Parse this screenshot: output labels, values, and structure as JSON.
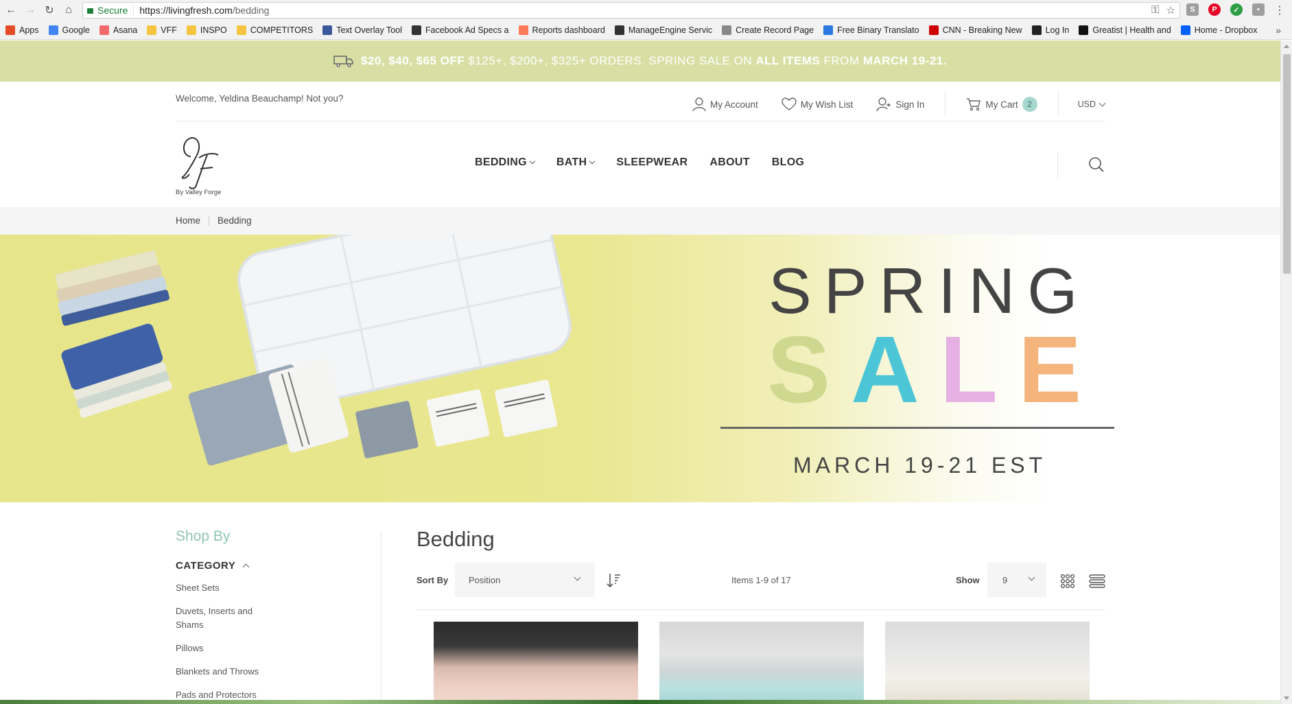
{
  "browser": {
    "secure_label": "Secure",
    "url_host": "https://livingfresh.com",
    "url_path": "/bedding",
    "bookmarks": [
      {
        "label": "Apps",
        "icon": "apps-grid-icon",
        "color": "#e34c26"
      },
      {
        "label": "Google",
        "icon": "google-icon",
        "color": "#4285f4"
      },
      {
        "label": "Asana",
        "icon": "asana-icon",
        "color": "#f06a6a"
      },
      {
        "label": "VFF",
        "icon": "folder-icon",
        "color": "#f5c542"
      },
      {
        "label": "INSPO",
        "icon": "folder-icon",
        "color": "#f5c542"
      },
      {
        "label": "COMPETITORS",
        "icon": "folder-icon",
        "color": "#f5c542"
      },
      {
        "label": "Text Overlay Tool",
        "icon": "facebook-icon",
        "color": "#3b5998"
      },
      {
        "label": "Facebook Ad Specs a",
        "icon": "layers-icon",
        "color": "#333333"
      },
      {
        "label": "Reports dashboard",
        "icon": "hubspot-icon",
        "color": "#ff7a59"
      },
      {
        "label": "ManageEngine Servic",
        "icon": "manageengine-icon",
        "color": "#333333"
      },
      {
        "label": "Create Record Page",
        "icon": "page-icon",
        "color": "#888888"
      },
      {
        "label": "Free Binary Translato",
        "icon": "w-icon",
        "color": "#2a7ae2"
      },
      {
        "label": "CNN - Breaking New",
        "icon": "cnn-icon",
        "color": "#cc0000"
      },
      {
        "label": "Log In",
        "icon": "big-icon",
        "color": "#222222"
      },
      {
        "label": "Greatist | Health and",
        "icon": "greatist-icon",
        "color": "#111111"
      },
      {
        "label": "Home - Dropbox",
        "icon": "dropbox-icon",
        "color": "#0061fe"
      }
    ]
  },
  "promo": {
    "amounts": "$20, $40, $65 OFF",
    "thresholds": "$125+, $200+, $325+ ORDERS. SPRING SALE ON",
    "all_items": "ALL ITEMS",
    "from": "FROM",
    "dates": "MARCH 19-21."
  },
  "topbar": {
    "welcome": "Welcome, Yeldina Beauchamp! Not you?",
    "my_account": "My Account",
    "wish_list": "My Wish List",
    "sign_in": "Sign In",
    "my_cart": "My Cart",
    "cart_count": "2",
    "currency": "USD"
  },
  "header": {
    "logo_sub": "By Valley Forge",
    "nav": [
      "BEDDING",
      "BATH",
      "SLEEPWEAR",
      "ABOUT",
      "BLOG"
    ]
  },
  "breadcrumb": {
    "home": "Home",
    "current": "Bedding"
  },
  "hero": {
    "line1": "SPRING",
    "sale_letters": [
      {
        "ch": "S",
        "color": "#cfd88f"
      },
      {
        "ch": "A",
        "color": "#4cc6d6"
      },
      {
        "ch": "L",
        "color": "#e6b0e4"
      },
      {
        "ch": "E",
        "color": "#f4b47b"
      }
    ],
    "date": "MARCH 19-21 EST"
  },
  "sidebar": {
    "shop_by": "Shop By",
    "category": "CATEGORY",
    "items": [
      "Sheet Sets",
      "Duvets, Inserts and Shams",
      "Pillows",
      "Blankets and Throws",
      "Pads and Protectors"
    ]
  },
  "main": {
    "title": "Bedding",
    "sort_by_label": "Sort By",
    "sort_value": "Position",
    "items_count": "Items 1-9 of 17",
    "show_label": "Show",
    "show_value": "9"
  },
  "colors": {
    "promo_bg": "#d8dfa4",
    "accent_teal": "#8fc3b7",
    "badge_bg": "#a7d8cf"
  }
}
